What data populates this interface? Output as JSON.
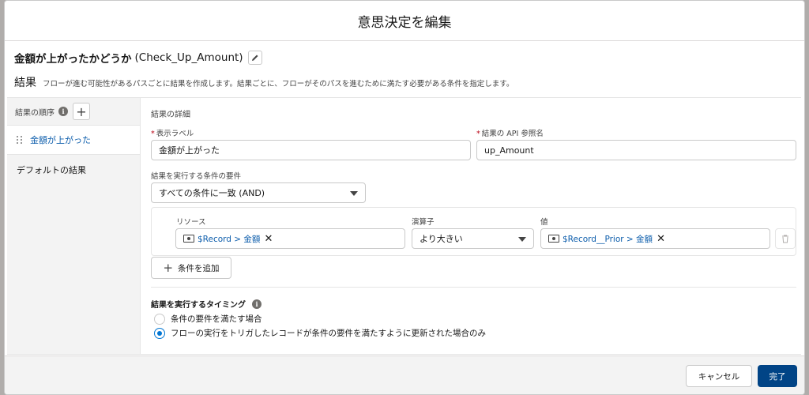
{
  "modal": {
    "title": "意思決定を編集",
    "element_label": "金額が上がったかどうか",
    "element_api": "(Check_Up_Amount)",
    "section_title": "結果",
    "section_desc": "フローが進む可能性があるパスごとに結果を作成します。結果ごとに、フローがそのパスを進むために満たす必要がある条件を指定します。"
  },
  "sidebar": {
    "order_label": "結果の順序",
    "add_symbol": "+",
    "outcomes": [
      {
        "label": "金額が上がった"
      },
      {
        "label": "デフォルトの結果"
      }
    ]
  },
  "details": {
    "title": "結果の詳細",
    "label_field": {
      "label": "表示ラベル",
      "value": "金額が上がった"
    },
    "api_field": {
      "label": "結果の API 参照名",
      "value": "up_Amount"
    },
    "requirement_label": "結果を実行する条件の要件",
    "requirement_value": "すべての条件に一致 (AND)",
    "condition": {
      "resource_label": "リソース",
      "resource_value": "$Record > 金額",
      "operator_label": "演算子",
      "operator_value": "より大きい",
      "value_label": "値",
      "value_value": "$Record__Prior > 金額",
      "remove_symbol": "✕"
    },
    "add_condition": "条件を追加",
    "add_condition_symbol": "+",
    "timing_title": "結果を実行するタイミング",
    "timing_options": [
      {
        "label": "条件の要件を満たす場合",
        "checked": false
      },
      {
        "label": "フローの実行をトリガしたレコードが条件の要件を満たすように更新された場合のみ",
        "checked": true
      }
    ],
    "required_mark": "*",
    "info_symbol": "i"
  },
  "footer": {
    "cancel": "キャンセル",
    "done": "完了"
  },
  "colors": {
    "accent": "#0176d3",
    "primary_button": "#014486",
    "link": "#0b5cab",
    "required": "#ba0517"
  }
}
